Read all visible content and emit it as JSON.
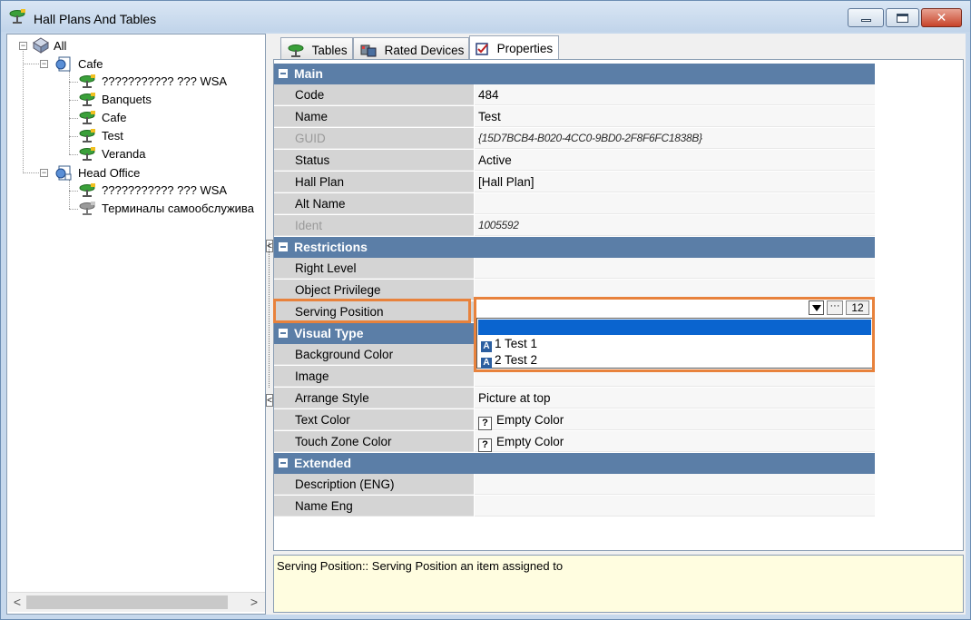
{
  "window": {
    "title": "Hall Plans And Tables",
    "close_glyph": "✕"
  },
  "tree": {
    "root": "All",
    "groups": [
      {
        "label": "Cafe",
        "children": [
          "??????????? ??? WSA",
          "Banquets",
          "Cafe",
          "Test",
          "Veranda"
        ]
      },
      {
        "label": "Head Office",
        "children": [
          "??????????? ??? WSA",
          "Терминалы самообслужива"
        ]
      }
    ],
    "scroll_left": "<",
    "scroll_right": ">"
  },
  "tabs": [
    {
      "label": "Tables",
      "icon": "table-icon"
    },
    {
      "label": "Rated Devices",
      "icon": "devices-icon"
    },
    {
      "label": "Properties",
      "icon": "properties-icon",
      "active": true
    }
  ],
  "splitter": {
    "grip": "<"
  },
  "properties": {
    "main": {
      "title": "Main",
      "rows": [
        {
          "name": "Code",
          "value": "484"
        },
        {
          "name": "Name",
          "value": "Test"
        },
        {
          "name": "GUID",
          "value": "{15D7BCB4-B020-4CC0-9BD0-2F8F6FC1838B}",
          "disabled": true
        },
        {
          "name": "Status",
          "value": "Active"
        },
        {
          "name": "Hall Plan",
          "value": "[Hall Plan]"
        },
        {
          "name": "Alt Name",
          "value": ""
        },
        {
          "name": "Ident",
          "value": "1005592",
          "disabled": true
        }
      ]
    },
    "restrictions": {
      "title": "Restrictions",
      "rows": [
        {
          "name": "Right Level",
          "value": ""
        },
        {
          "name": "Object Privilege",
          "value": ""
        },
        {
          "name": "Serving Position",
          "value": ""
        }
      ]
    },
    "serving_position_combo": {
      "ellipsis": "···",
      "count": "12",
      "options": [
        {
          "badge": "A",
          "label": "1 Test 1"
        },
        {
          "badge": "A",
          "label": "2 Test 2"
        }
      ]
    },
    "visual_type": {
      "title": "Visual Type",
      "rows": [
        {
          "name": "Background Color",
          "value": ""
        },
        {
          "name": "Image",
          "value": ""
        },
        {
          "name": "Arrange Style",
          "value": "Picture at top"
        },
        {
          "name": "Text Color",
          "value": "Empty Color",
          "badge": "?"
        },
        {
          "name": "Touch Zone Color",
          "value": "Empty Color",
          "badge": "?"
        }
      ]
    },
    "extended": {
      "title": "Extended",
      "rows": [
        {
          "name": "Description (ENG)",
          "value": ""
        },
        {
          "name": "Name Eng",
          "value": ""
        }
      ]
    }
  },
  "description": "Serving Position:: Serving Position an item assigned to",
  "colors": {
    "category_header": "#5b7ea7",
    "highlight": "#e8823c",
    "selection": "#0a64cf",
    "description_bg": "#fffde0"
  }
}
